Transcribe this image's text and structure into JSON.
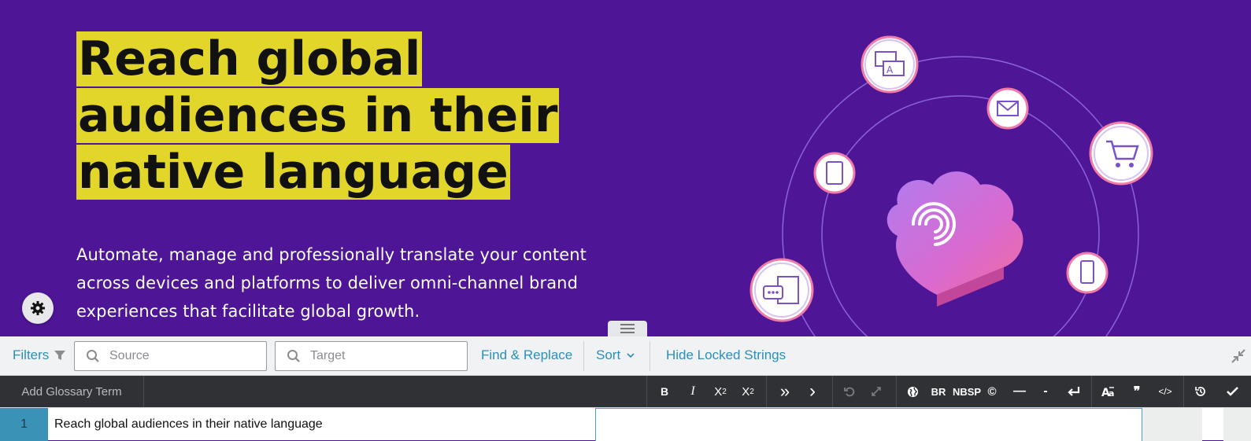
{
  "hero": {
    "headline_lines": [
      "Reach global",
      "audiences in their",
      "native language"
    ],
    "subtitle_lines": [
      "Automate, manage and professionally translate your content",
      "across devices and platforms to deliver omni-channel brand",
      "experiences that facilitate global growth."
    ]
  },
  "filterbar": {
    "filters_label": "Filters",
    "source_placeholder": "Source",
    "target_placeholder": "Target",
    "find_replace_label": "Find & Replace",
    "sort_label": "Sort",
    "hide_locked_label": "Hide Locked Strings"
  },
  "toolbar": {
    "add_glossary_label": "Add Glossary Term",
    "bold": "B",
    "italic": "I",
    "superscript": "X",
    "superscript_mark": "2",
    "subscript": "X",
    "subscript_mark": "2",
    "double_chevron": "»",
    "single_chevron": "›",
    "br": "BR",
    "nbsp": "NBSP",
    "copyright": "©",
    "em_dash": "—",
    "hyphen": "-",
    "quote": "❞",
    "code": "</>"
  },
  "row": {
    "number": "1",
    "source_text": "Reach global audiences in their native language",
    "target_text": ""
  },
  "colors": {
    "hero_bg": "#4e1596",
    "highlight": "#e3d62a",
    "link": "#2a8fb9",
    "toolbar_bg": "#2f3134",
    "row_number_bg": "#3a93b7"
  }
}
